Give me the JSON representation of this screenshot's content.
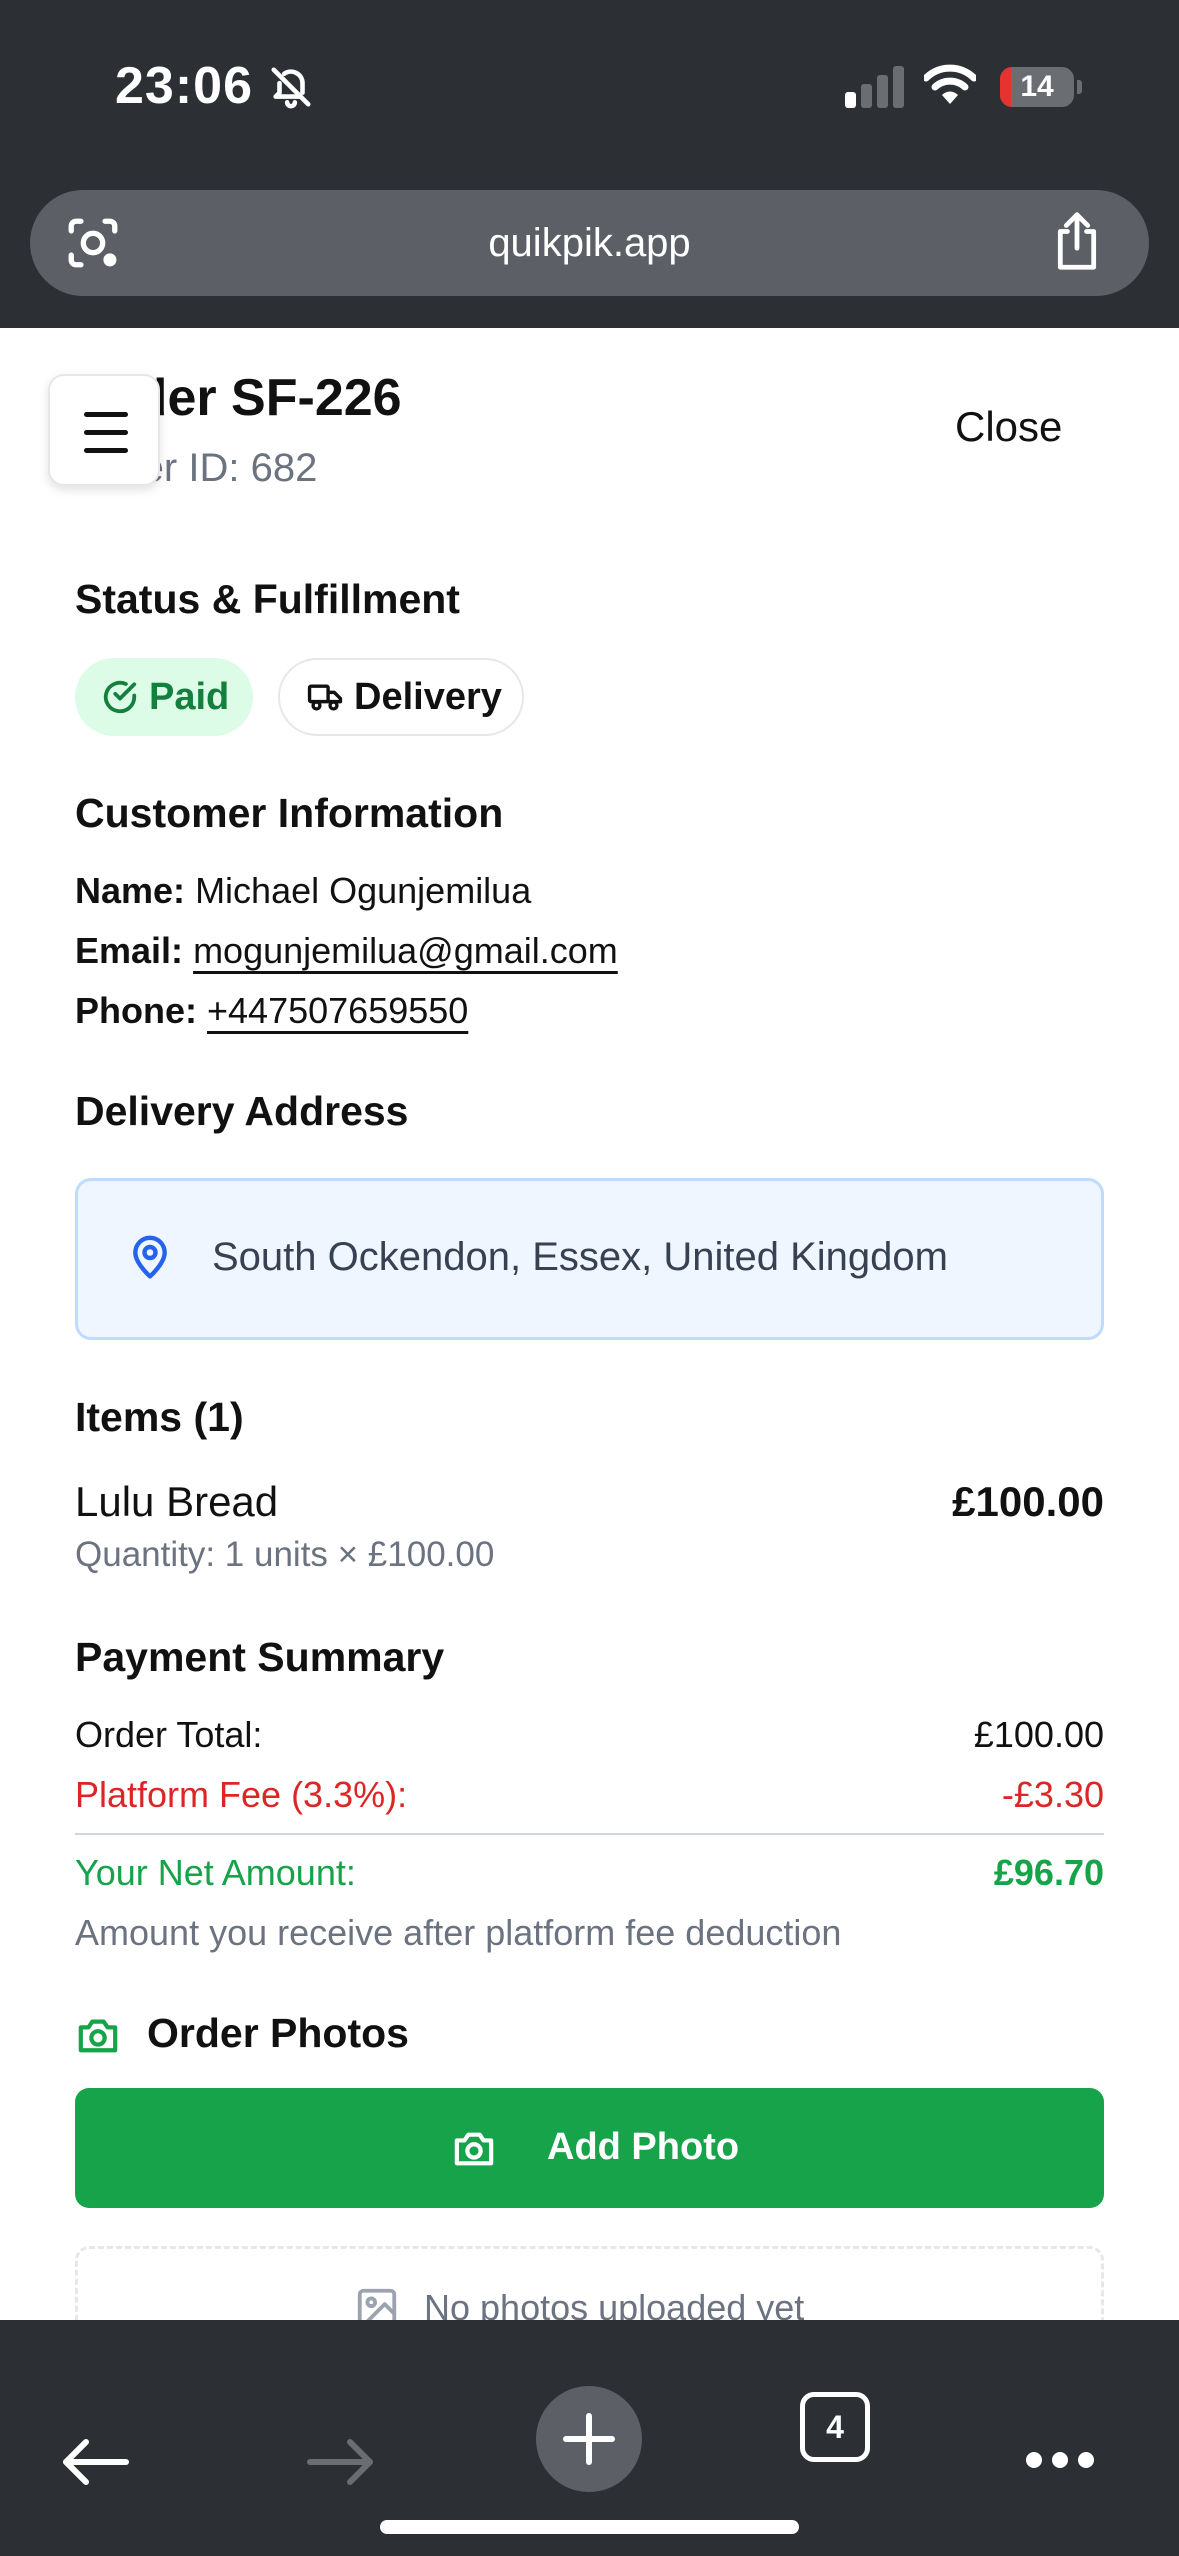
{
  "status_bar": {
    "time": "23:06",
    "battery": "14"
  },
  "browser": {
    "url": "quikpik.app",
    "tab_count": "4"
  },
  "order": {
    "title": "Order SF-226",
    "subtitle": "Order ID: 682",
    "close_label": "Close"
  },
  "status_section": {
    "heading": "Status & Fulfillment",
    "paid_label": "Paid",
    "delivery_label": "Delivery"
  },
  "customer": {
    "heading": "Customer Information",
    "name_key": "Name:",
    "name": "Michael Ogunjemilua",
    "email_key": "Email:",
    "email": "mogunjemilua@gmail.com",
    "phone_key": "Phone:",
    "phone": "+447507659550"
  },
  "delivery": {
    "heading": "Delivery Address",
    "address": "South Ockendon, Essex, United Kingdom"
  },
  "items": {
    "heading": "Items (1)",
    "list": [
      {
        "name": "Lulu Bread",
        "price": "£100.00",
        "quantity": "Quantity: 1 units × £100.00"
      }
    ]
  },
  "payment": {
    "heading": "Payment Summary",
    "total_label": "Order Total:",
    "total": "£100.00",
    "fee_label": "Platform Fee (3.3%):",
    "fee": "-£3.30",
    "net_label": "Your Net Amount:",
    "net": "£96.70",
    "note": "Amount you receive after platform fee deduction"
  },
  "photos": {
    "heading": "Order Photos",
    "add_label": "Add Photo",
    "empty_label": "No photos uploaded yet"
  },
  "colors": {
    "green": "#16a34a",
    "red": "#dc2626",
    "paid_bg": "#dcfce7",
    "address_bg": "#eff6ff",
    "pin_blue": "#2563eb"
  },
  "icons": [
    "bell-slash-icon",
    "signal-icon",
    "wifi-icon",
    "battery-icon",
    "google-lens-icon",
    "share-icon",
    "menu-icon",
    "check-circle-icon",
    "truck-icon",
    "map-pin-icon",
    "camera-icon",
    "image-icon",
    "back-arrow-icon",
    "forward-arrow-icon",
    "plus-icon",
    "tabs-icon",
    "more-icon"
  ]
}
